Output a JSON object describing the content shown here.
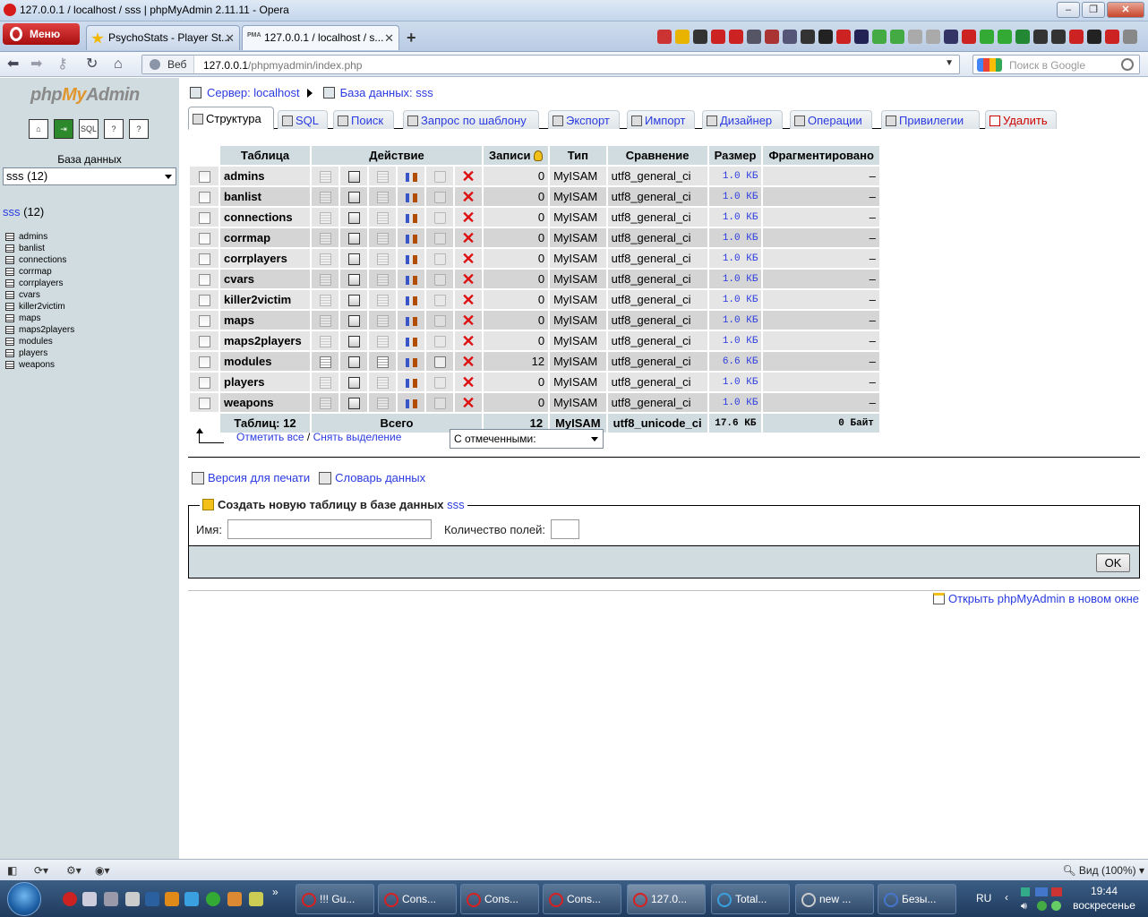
{
  "window": {
    "title": "127.0.0.1 / localhost / sss | phpMyAdmin 2.11.11 - Opera"
  },
  "browser": {
    "menu_label": "Меню",
    "tabs": [
      {
        "label": "PsychoStats - Player St..."
      },
      {
        "label": "127.0.0.1 / localhost / s..."
      }
    ],
    "address": {
      "web_label": "Веб",
      "host": "127.0.0.1",
      "path": "/phpmyadmin/index.php"
    },
    "search_placeholder": "Поиск в Google"
  },
  "left": {
    "logo_php": "php",
    "logo_my": "My",
    "logo_admin": "Admin",
    "db_label": "База данных",
    "db_select": "sss (12)",
    "db_title_link": "sss",
    "db_title_count": "(12)",
    "tables": [
      "admins",
      "banlist",
      "connections",
      "corrmap",
      "corrplayers",
      "cvars",
      "killer2victim",
      "maps",
      "maps2players",
      "modules",
      "players",
      "weapons"
    ]
  },
  "breadcrumb": {
    "server": "Сервер: localhost",
    "database": "База данных: sss"
  },
  "tabs": [
    {
      "label": "Структура"
    },
    {
      "label": "SQL"
    },
    {
      "label": "Поиск"
    },
    {
      "label": "Запрос по шаблону"
    },
    {
      "label": "Экспорт"
    },
    {
      "label": "Импорт"
    },
    {
      "label": "Дизайнер"
    },
    {
      "label": "Операции"
    },
    {
      "label": "Привилегии"
    },
    {
      "label": "Удалить"
    }
  ],
  "table": {
    "headers": {
      "table": "Таблица",
      "action": "Действие",
      "records": "Записи",
      "type": "Тип",
      "collation": "Сравнение",
      "size": "Размер",
      "overhead": "Фрагментировано"
    },
    "rows": [
      {
        "name": "admins",
        "records": "0",
        "type": "MyISAM",
        "collation": "utf8_general_ci",
        "size": "1.0 КБ",
        "overhead": "–"
      },
      {
        "name": "banlist",
        "records": "0",
        "type": "MyISAM",
        "collation": "utf8_general_ci",
        "size": "1.0 КБ",
        "overhead": "–"
      },
      {
        "name": "connections",
        "records": "0",
        "type": "MyISAM",
        "collation": "utf8_general_ci",
        "size": "1.0 КБ",
        "overhead": "–"
      },
      {
        "name": "corrmap",
        "records": "0",
        "type": "MyISAM",
        "collation": "utf8_general_ci",
        "size": "1.0 КБ",
        "overhead": "–"
      },
      {
        "name": "corrplayers",
        "records": "0",
        "type": "MyISAM",
        "collation": "utf8_general_ci",
        "size": "1.0 КБ",
        "overhead": "–"
      },
      {
        "name": "cvars",
        "records": "0",
        "type": "MyISAM",
        "collation": "utf8_general_ci",
        "size": "1.0 КБ",
        "overhead": "–"
      },
      {
        "name": "killer2victim",
        "records": "0",
        "type": "MyISAM",
        "collation": "utf8_general_ci",
        "size": "1.0 КБ",
        "overhead": "–"
      },
      {
        "name": "maps",
        "records": "0",
        "type": "MyISAM",
        "collation": "utf8_general_ci",
        "size": "1.0 КБ",
        "overhead": "–"
      },
      {
        "name": "maps2players",
        "records": "0",
        "type": "MyISAM",
        "collation": "utf8_general_ci",
        "size": "1.0 КБ",
        "overhead": "–"
      },
      {
        "name": "modules",
        "records": "12",
        "type": "MyISAM",
        "collation": "utf8_general_ci",
        "size": "6.6 КБ",
        "overhead": "–"
      },
      {
        "name": "players",
        "records": "0",
        "type": "MyISAM",
        "collation": "utf8_general_ci",
        "size": "1.0 КБ",
        "overhead": "–"
      },
      {
        "name": "weapons",
        "records": "0",
        "type": "MyISAM",
        "collation": "utf8_general_ci",
        "size": "1.0 КБ",
        "overhead": "–"
      }
    ],
    "footer": {
      "tables": "Таблиц: 12",
      "total": "Всего",
      "records": "12",
      "type": "MyISAM",
      "collation": "utf8_unicode_ci",
      "size": "17.6 КБ",
      "overhead": "0 Байт"
    }
  },
  "bulk": {
    "check_all": "Отметить все",
    "sep": " / ",
    "uncheck_all": "Снять выделение",
    "with_selected": "С отмеченными:"
  },
  "links": {
    "print": "Версия для печати",
    "dictionary": "Словарь данных"
  },
  "create": {
    "legend": "Создать новую таблицу в базе данных",
    "db": "sss",
    "name_label": "Имя:",
    "fields_label": "Количество полей:",
    "ok": "OK"
  },
  "open_new_window": "Открыть phpMyAdmin в новом окне",
  "statusbar": {
    "zoom": "Вид (100%)"
  },
  "taskbar": {
    "buttons": [
      "!!! Gu...",
      "Cons...",
      "Cons...",
      "Cons...",
      "127.0...",
      "Total...",
      "new ...",
      "Безы..."
    ],
    "lang": "RU",
    "time": "19:44",
    "day": "воскресенье"
  }
}
